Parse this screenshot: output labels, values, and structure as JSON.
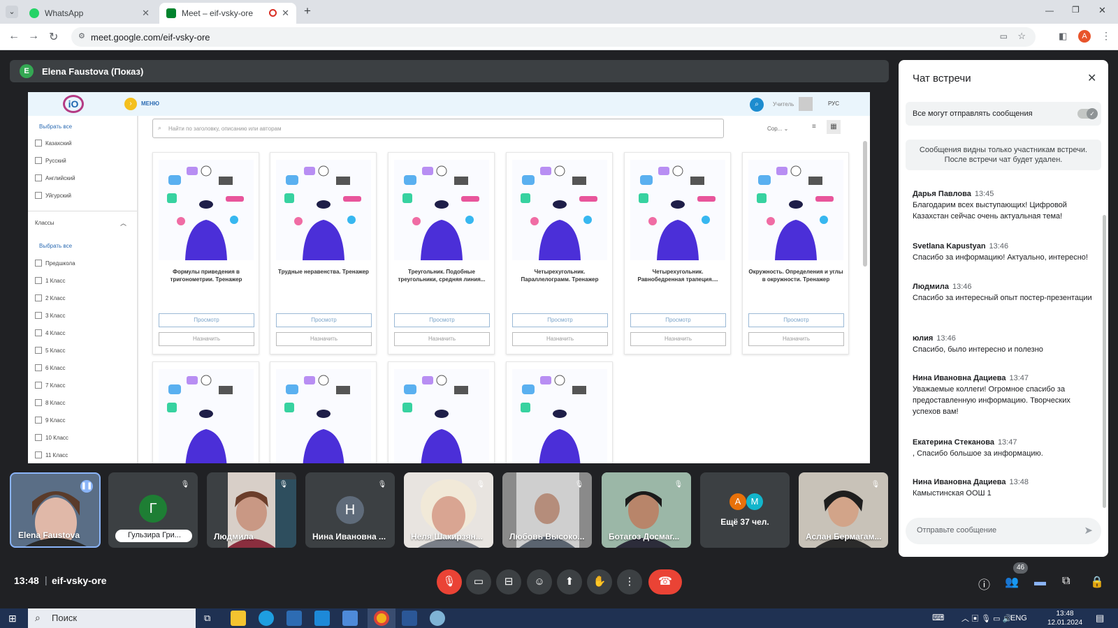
{
  "browser": {
    "tabs": [
      {
        "title": "WhatsApp",
        "color": "#25d366"
      },
      {
        "title": "Meet – eif-vsky-ore",
        "color": "#00832d"
      }
    ],
    "url": "meet.google.com/eif-vsky-ore",
    "profile_initial": "A"
  },
  "presenter": {
    "initial": "E",
    "label": "Elena Faustova (Показ)"
  },
  "shared_screen": {
    "menu_label": "МЕНЮ",
    "role_label": "Учитель",
    "lang_label": "РУС",
    "search_placeholder": "Найти по заголовку, описанию или авторам",
    "sort_label": "Сор...",
    "languages": {
      "select_all": "Выбрать все",
      "items": [
        "Казахский",
        "Русский",
        "Английский",
        "Уйгурский"
      ]
    },
    "classes": {
      "header": "Классы",
      "select_all": "Выбрать все",
      "items": [
        "Предшкола",
        "1 Класс",
        "2 Класс",
        "3 Класс",
        "4 Класс",
        "5 Класс",
        "6 Класс",
        "7 Класс",
        "8 Класс",
        "9 Класс",
        "10 Класс",
        "11 Класс"
      ]
    },
    "cards": [
      {
        "title": "Формулы приведения в тригонометрии. Тренажер",
        "view": "Просмотр",
        "assign": "Назначить"
      },
      {
        "title": "Трудные неравенства. Тренажер",
        "view": "Просмотр",
        "assign": "Назначить"
      },
      {
        "title": "Треугольник. Подобные треугольники, средняя линия...",
        "view": "Просмотр",
        "assign": "Назначить"
      },
      {
        "title": "Четырехугольник. Параллелограмм. Тренажер",
        "view": "Просмотр",
        "assign": "Назначить"
      },
      {
        "title": "Четырехугольник. Равнобедренная трапеция....",
        "view": "Просмотр",
        "assign": "Назначить"
      },
      {
        "title": "Окружность. Определения и углы в окружности. Тренажер",
        "view": "Просмотр",
        "assign": "Назначить"
      }
    ]
  },
  "chat": {
    "title": "Чат встречи",
    "toggle_label": "Все могут отправлять сообщения",
    "notice": "Сообщения видны только участникам встречи. После встречи чат будет удален.",
    "messages": [
      {
        "author": "Дарья Павлова",
        "time": "13:45",
        "text": "Благодарим всех выступающих! Цифровой Казахстан сейчас очень актуальная тема!"
      },
      {
        "author": "Svetlana Kapustyan",
        "time": "13:46",
        "text": "Спасибо за информацию! Актуально, интересно!"
      },
      {
        "author": "Людмила",
        "time": "13:46",
        "text": "Спасибо за интересный опыт постер-презентации"
      },
      {
        "author": "юлия",
        "time": "13:46",
        "text": "Спасибо, было интересно и полезно"
      },
      {
        "author": "Нина Ивановна Дациева",
        "time": "13:47",
        "text": "Уважаемые коллеги! Огромное спасибо за предоставленную информацию. Творческих успехов вам!"
      },
      {
        "author": "Екатерина Стеканова",
        "time": "13:47",
        "text": ", Спасибо большое за информацию."
      },
      {
        "author": "Нина Ивановна Дациева",
        "time": "13:48",
        "text": "Камыстинская ООШ 1"
      }
    ],
    "input_placeholder": "Отправьте сообщение"
  },
  "participants": [
    {
      "name": "Elena Faustova"
    },
    {
      "name": "Гульзира Гри...",
      "initial": "Г"
    },
    {
      "name": "Людмила"
    },
    {
      "name": "Нина Ивановна ...",
      "initial": "Н"
    },
    {
      "name": "Неля Шакирзян..."
    },
    {
      "name": "Любовь Высоко..."
    },
    {
      "name": "Ботагоз Досмаг..."
    },
    {
      "name": "Ещё 37 чел.",
      "initials": [
        "А",
        "М"
      ]
    },
    {
      "name": "Аслан Бермагам..."
    }
  ],
  "meeting": {
    "time": "13:48",
    "code": "eif-vsky-ore",
    "participant_count": "46"
  },
  "taskbar": {
    "search": "Поиск",
    "lang": "ENG",
    "time": "13:48",
    "date": "12.01.2024"
  }
}
